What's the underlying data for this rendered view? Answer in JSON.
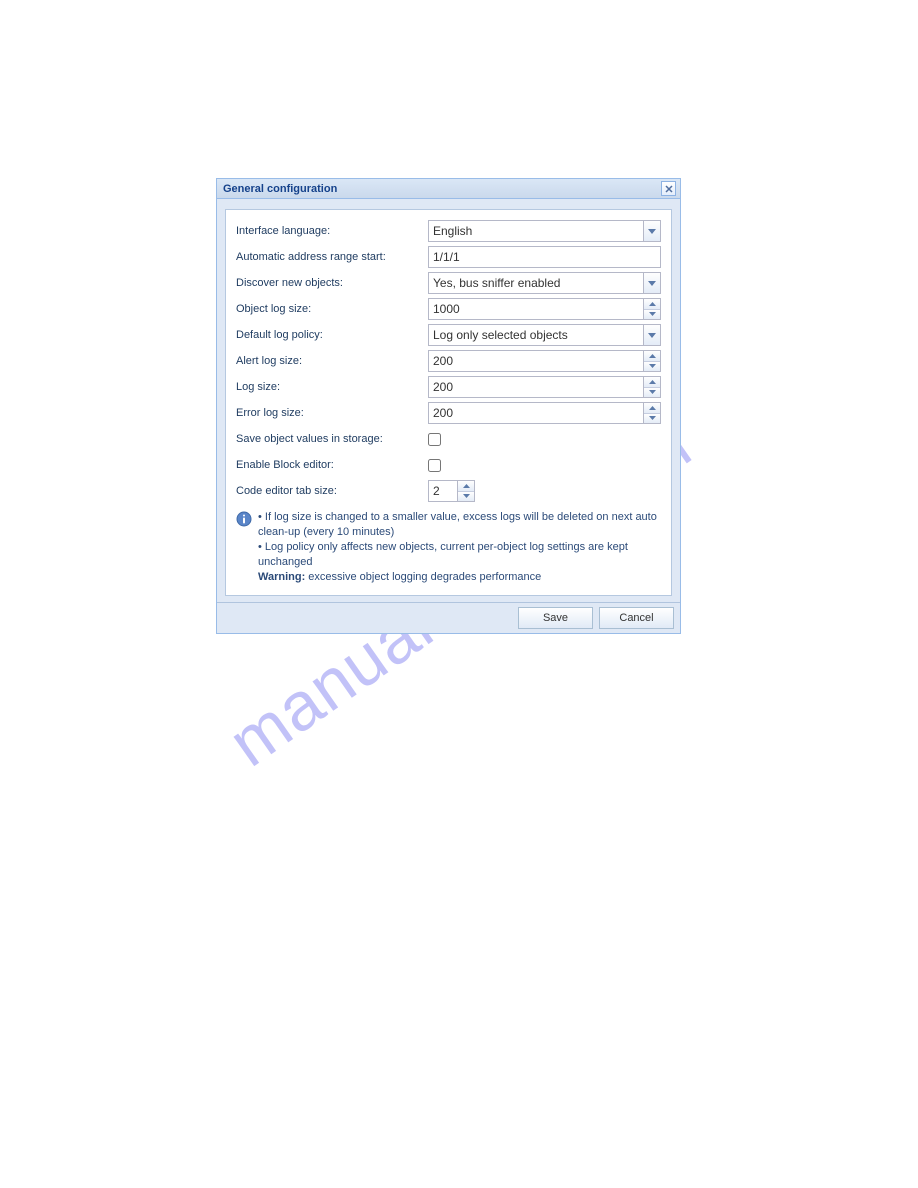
{
  "dialog": {
    "title": "General configuration"
  },
  "form": {
    "interface_language": {
      "label": "Interface language:",
      "value": "English"
    },
    "auto_addr_start": {
      "label": "Automatic address range start:",
      "value": "1/1/1"
    },
    "discover": {
      "label": "Discover new objects:",
      "value": "Yes, bus sniffer enabled"
    },
    "object_log_size": {
      "label": "Object log size:",
      "value": "1000"
    },
    "default_log_policy": {
      "label": "Default log policy:",
      "value": "Log only selected objects"
    },
    "alert_log_size": {
      "label": "Alert log size:",
      "value": "200"
    },
    "log_size": {
      "label": "Log size:",
      "value": "200"
    },
    "error_log_size": {
      "label": "Error log size:",
      "value": "200"
    },
    "save_storage": {
      "label": "Save object values in storage:"
    },
    "enable_block": {
      "label": "Enable Block editor:"
    },
    "tab_size": {
      "label": "Code editor tab size:",
      "value": "2"
    }
  },
  "info": {
    "line1": "• If log size is changed to a smaller value, excess logs will be deleted on next auto clean-up (every 10 minutes)",
    "line2": "• Log policy only affects new objects, current per-object log settings are kept unchanged",
    "warning_label": "Warning:",
    "warning_text": " excessive object logging degrades performance"
  },
  "buttons": {
    "save": "Save",
    "cancel": "Cancel"
  },
  "watermark": "manualshive.com"
}
